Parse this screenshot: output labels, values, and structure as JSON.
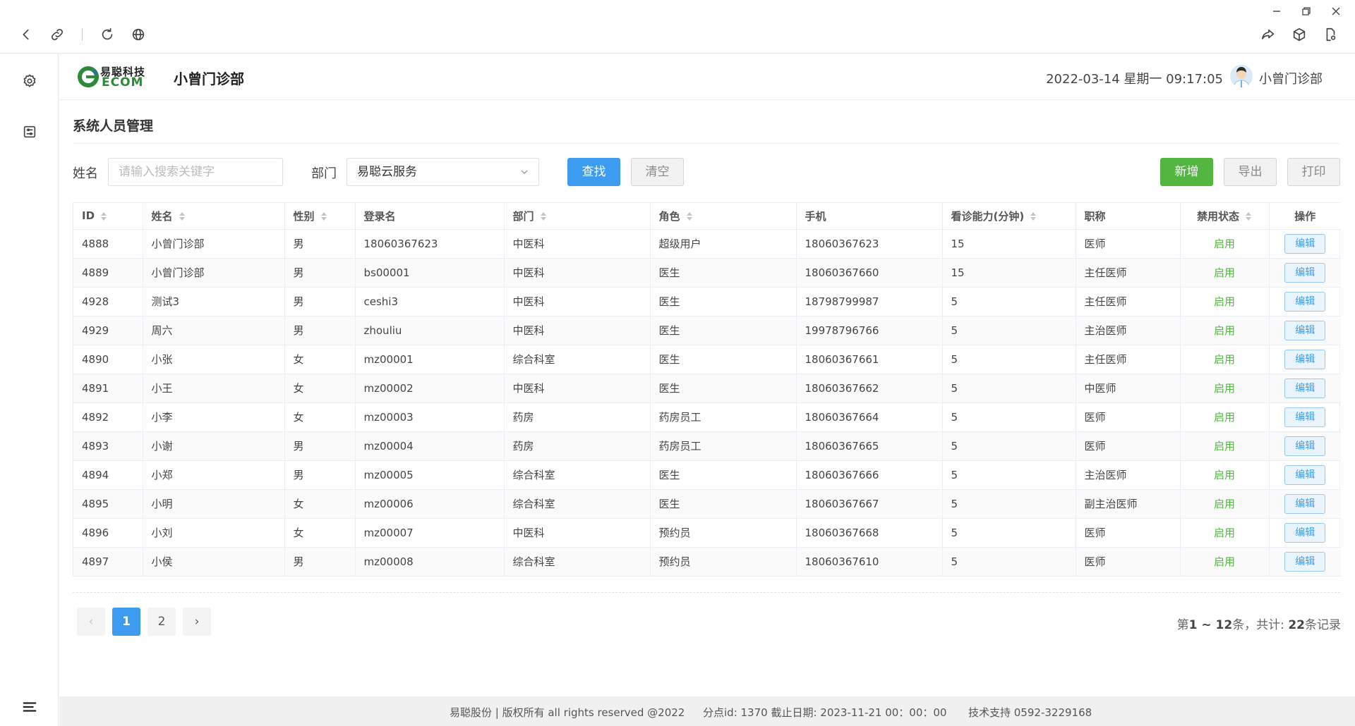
{
  "window_controls": [
    "minimize-icon",
    "restore-icon",
    "close-icon"
  ],
  "header": {
    "logo_text_cn": "易聪科技",
    "logo_text_en": "ECOM",
    "title": "小曾门诊部",
    "datetime": "2022-03-14 星期一 09:17:05",
    "user_name": "小曾门诊部"
  },
  "page": {
    "title": "系统人员管理"
  },
  "filters": {
    "name_label": "姓名",
    "name_placeholder": "请输入搜索关键字",
    "name_value": "",
    "dept_label": "部门",
    "dept_value": "易聪云服务",
    "search_label": "查找",
    "clear_label": "清空",
    "add_label": "新增",
    "export_label": "导出",
    "print_label": "打印"
  },
  "table": {
    "columns": [
      "ID",
      "姓名",
      "性别",
      "登录名",
      "部门",
      "角色",
      "手机",
      "看诊能力(分钟)",
      "职称",
      "禁用状态",
      "操作"
    ],
    "edit_label": "编辑",
    "rows": [
      {
        "id": "4888",
        "name": "小曾门诊部",
        "gender": "男",
        "login": "18060367623",
        "dept": "中医科",
        "role": "超级用户",
        "phone": "18060367623",
        "capacity": "15",
        "title": "医师",
        "status": "启用"
      },
      {
        "id": "4889",
        "name": "小曾门诊部",
        "gender": "男",
        "login": "bs00001",
        "dept": "中医科",
        "role": "医生",
        "phone": "18060367660",
        "capacity": "15",
        "title": "主任医师",
        "status": "启用"
      },
      {
        "id": "4928",
        "name": "测试3",
        "gender": "男",
        "login": "ceshi3",
        "dept": "中医科",
        "role": "医生",
        "phone": "18798799987",
        "capacity": "5",
        "title": "主任医师",
        "status": "启用"
      },
      {
        "id": "4929",
        "name": "周六",
        "gender": "男",
        "login": "zhouliu",
        "dept": "中医科",
        "role": "医生",
        "phone": "19978796766",
        "capacity": "5",
        "title": "主治医师",
        "status": "启用"
      },
      {
        "id": "4890",
        "name": "小张",
        "gender": "女",
        "login": "mz00001",
        "dept": "综合科室",
        "role": "医生",
        "phone": "18060367661",
        "capacity": "5",
        "title": "主任医师",
        "status": "启用"
      },
      {
        "id": "4891",
        "name": "小王",
        "gender": "女",
        "login": "mz00002",
        "dept": "中医科",
        "role": "医生",
        "phone": "18060367662",
        "capacity": "5",
        "title": "中医师",
        "status": "启用"
      },
      {
        "id": "4892",
        "name": "小李",
        "gender": "女",
        "login": "mz00003",
        "dept": "药房",
        "role": "药房员工",
        "phone": "18060367664",
        "capacity": "5",
        "title": "医师",
        "status": "启用"
      },
      {
        "id": "4893",
        "name": "小谢",
        "gender": "男",
        "login": "mz00004",
        "dept": "药房",
        "role": "药房员工",
        "phone": "18060367665",
        "capacity": "5",
        "title": "医师",
        "status": "启用"
      },
      {
        "id": "4894",
        "name": "小郑",
        "gender": "男",
        "login": "mz00005",
        "dept": "综合科室",
        "role": "医生",
        "phone": "18060367666",
        "capacity": "5",
        "title": "主治医师",
        "status": "启用"
      },
      {
        "id": "4895",
        "name": "小明",
        "gender": "女",
        "login": "mz00006",
        "dept": "综合科室",
        "role": "医生",
        "phone": "18060367667",
        "capacity": "5",
        "title": "副主治医师",
        "status": "启用"
      },
      {
        "id": "4896",
        "name": "小刘",
        "gender": "女",
        "login": "mz00007",
        "dept": "中医科",
        "role": "预约员",
        "phone": "18060367668",
        "capacity": "5",
        "title": "医师",
        "status": "启用"
      },
      {
        "id": "4897",
        "name": "小侯",
        "gender": "男",
        "login": "mz00008",
        "dept": "综合科室",
        "role": "预约员",
        "phone": "18060367610",
        "capacity": "5",
        "title": "医师",
        "status": "启用"
      }
    ]
  },
  "pagination": {
    "prev": "‹",
    "pages": [
      "1",
      "2"
    ],
    "current": "1",
    "next": "›",
    "summary_prefix": "第",
    "summary_range": "1 ~ 12",
    "summary_mid": "条，共计: ",
    "summary_total": "22",
    "summary_suffix": "条记录"
  },
  "footer": {
    "copyright": "易聪股份 | 版权所有 all rights reserved @2022",
    "branch": "分点id: 1370 截止日期:   2023-11-21 00：00：00",
    "support": "技术支持 0592-3229168"
  },
  "colors": {
    "primary": "#3d9cf0",
    "success": "#52b640",
    "footer_bg": "#f0f0f0"
  }
}
